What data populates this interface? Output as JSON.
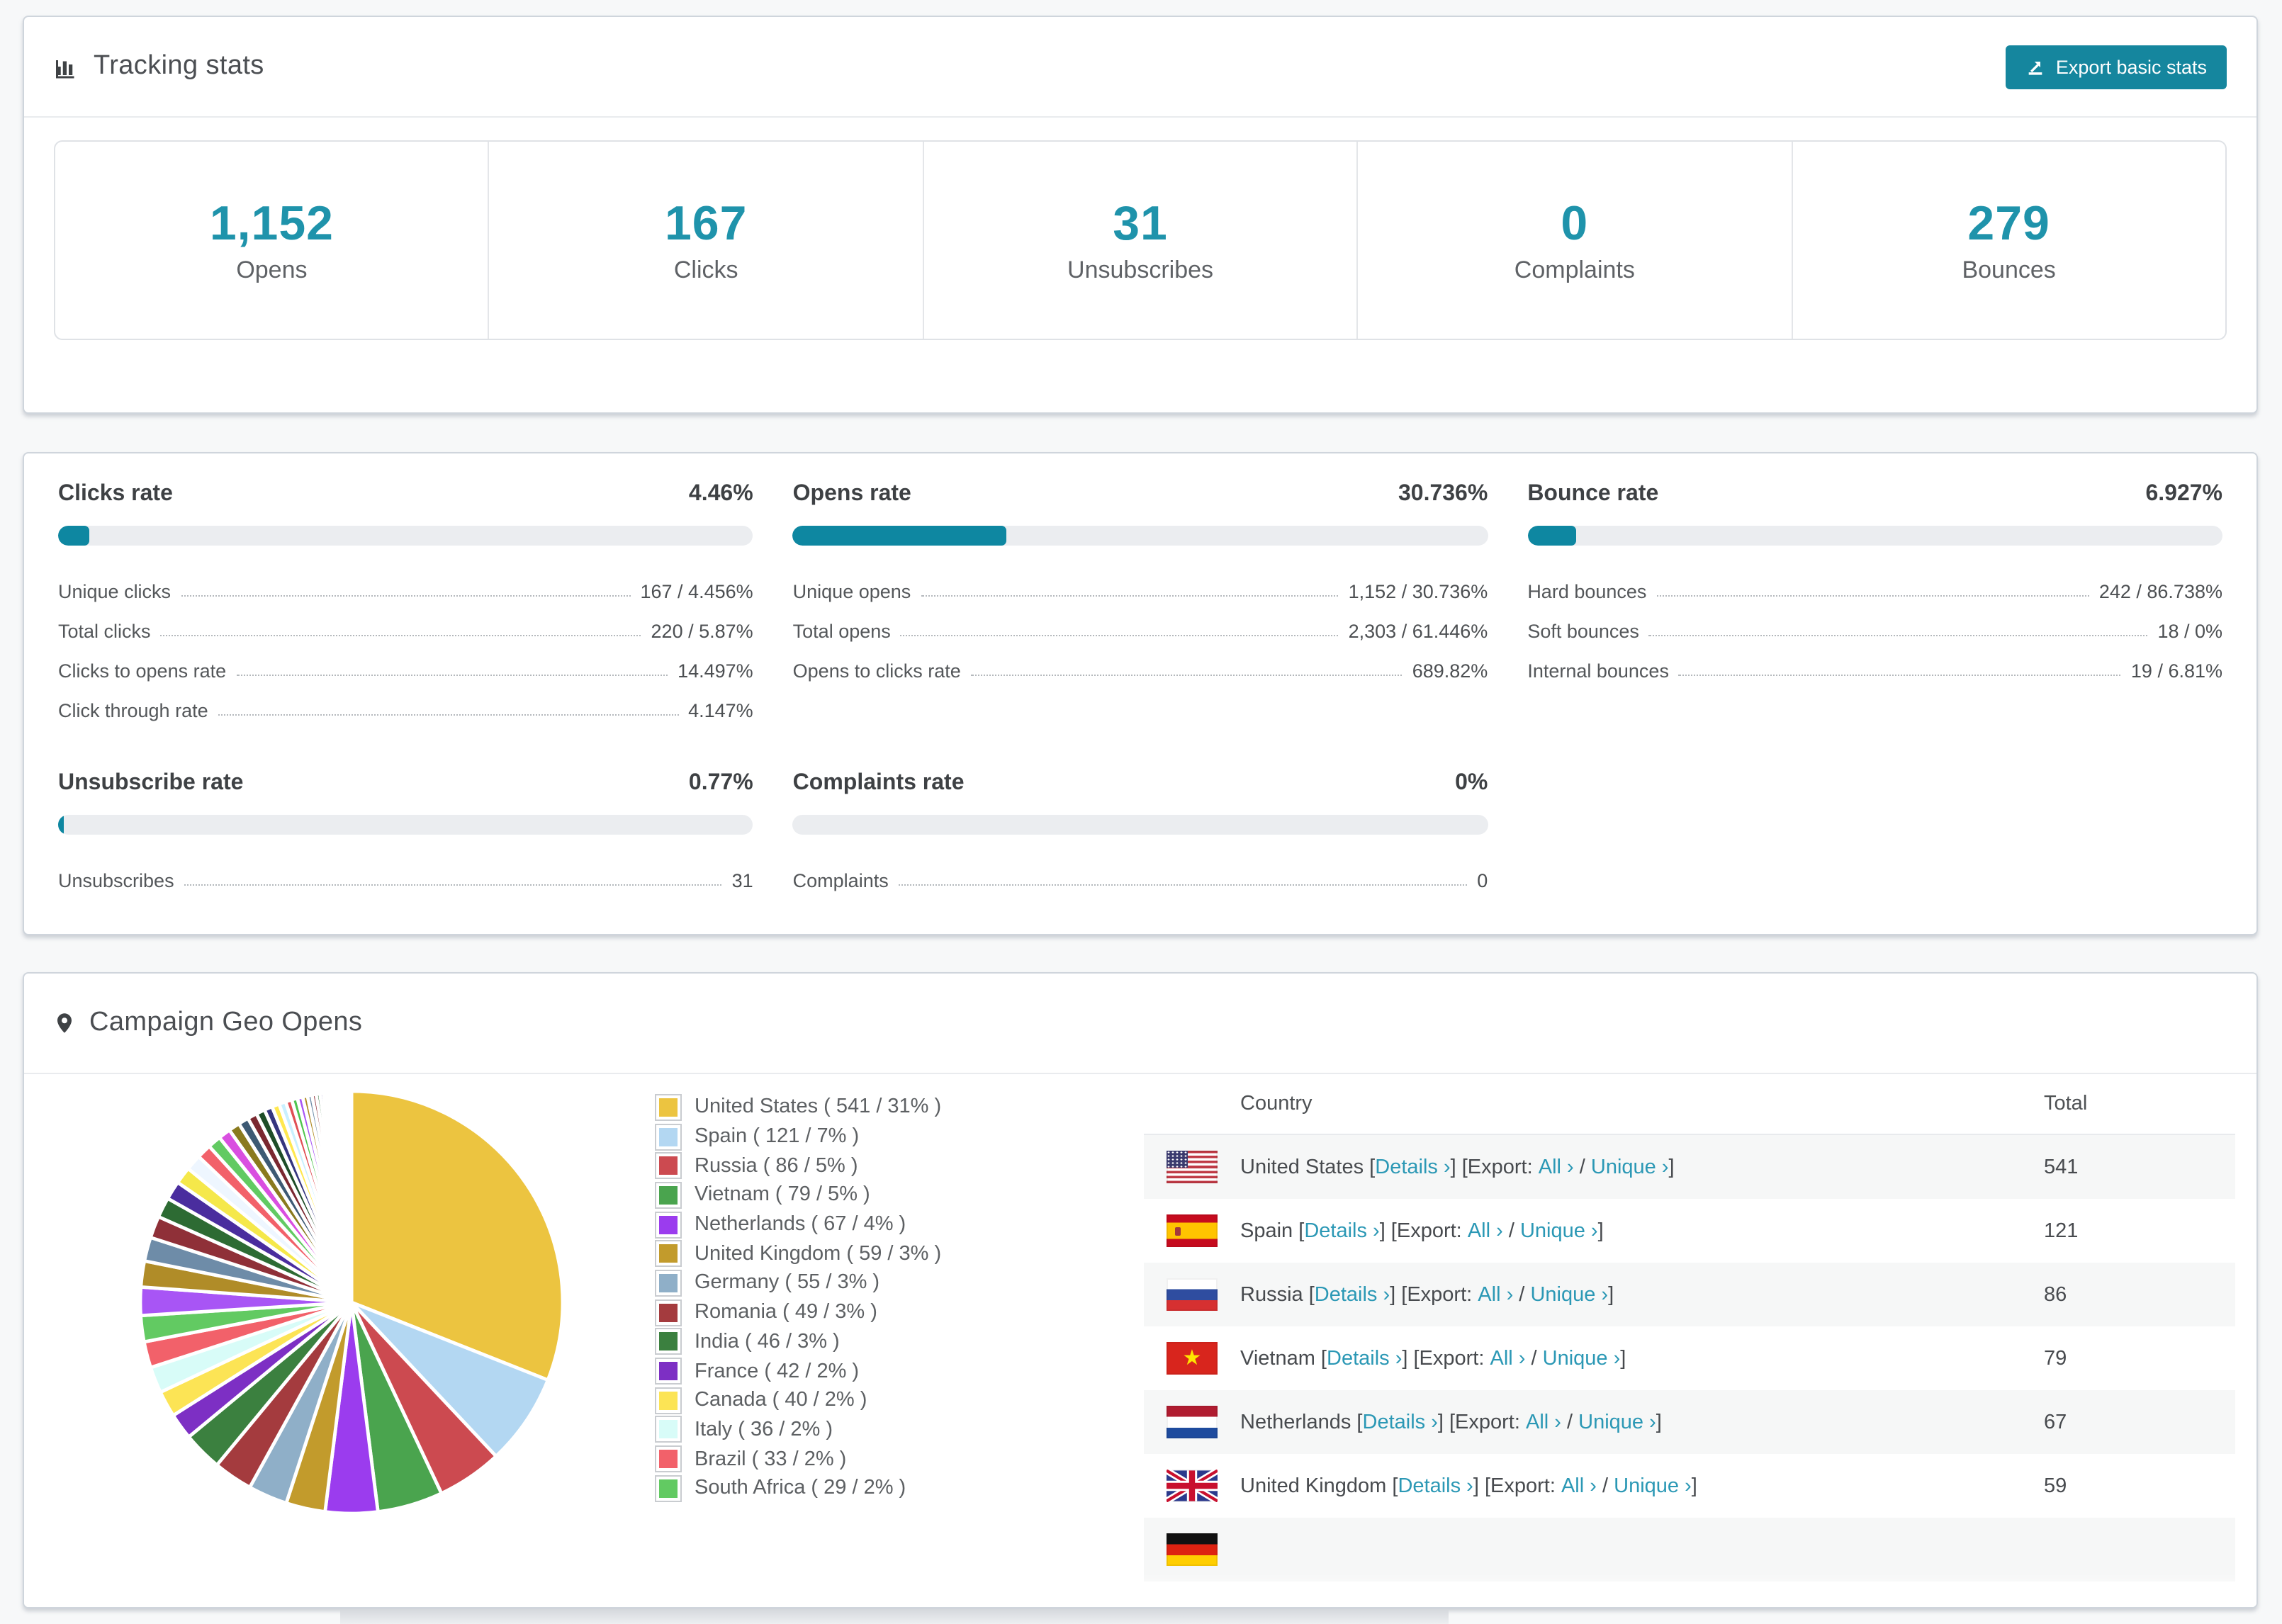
{
  "page": {
    "background": "#f7f8f9",
    "accent_teal": "#15869e",
    "bar_teal": "#0e87a1",
    "link_teal": "#2b98b5",
    "number_teal": "#1f93ab"
  },
  "tracking": {
    "title": "Tracking stats",
    "header_icon": "bar-chart-icon",
    "export_button": {
      "label": "Export basic stats",
      "icon": "export-icon"
    },
    "stats": [
      {
        "value": "1,152",
        "label": "Opens"
      },
      {
        "value": "167",
        "label": "Clicks"
      },
      {
        "value": "31",
        "label": "Unsubscribes"
      },
      {
        "value": "0",
        "label": "Complaints"
      },
      {
        "value": "279",
        "label": "Bounces"
      }
    ]
  },
  "rates": [
    {
      "id": "clicks-rate",
      "title": "Clicks rate",
      "value": "4.46%",
      "bar_percent": 4.46,
      "rows": [
        {
          "label": "Unique clicks",
          "value": "167 / 4.456%"
        },
        {
          "label": "Total clicks",
          "value": "220 / 5.87%"
        },
        {
          "label": "Clicks to opens rate",
          "value": "14.497%"
        },
        {
          "label": "Click through rate",
          "value": "4.147%"
        }
      ]
    },
    {
      "id": "opens-rate",
      "title": "Opens rate",
      "value": "30.736%",
      "bar_percent": 30.736,
      "rows": [
        {
          "label": "Unique opens",
          "value": "1,152 / 30.736%"
        },
        {
          "label": "Total opens",
          "value": "2,303 / 61.446%"
        },
        {
          "label": "Opens to clicks rate",
          "value": "689.82%"
        }
      ]
    },
    {
      "id": "bounce-rate",
      "title": "Bounce rate",
      "value": "6.927%",
      "bar_percent": 6.927,
      "rows": [
        {
          "label": "Hard bounces",
          "value": "242 / 86.738%"
        },
        {
          "label": "Soft bounces",
          "value": "18 / 0%"
        },
        {
          "label": "Internal bounces",
          "value": "19 / 6.81%"
        }
      ]
    },
    {
      "id": "unsubscribe-rate",
      "title": "Unsubscribe rate",
      "value": "0.77%",
      "bar_percent": 0.77,
      "rows": [
        {
          "label": "Unsubscribes",
          "value": "31"
        }
      ]
    },
    {
      "id": "complaints-rate",
      "title": "Complaints rate",
      "value": "0%",
      "bar_percent": 0,
      "rows": [
        {
          "label": "Complaints",
          "value": "0"
        }
      ]
    }
  ],
  "geo": {
    "title": "Campaign Geo Opens",
    "header_icon": "map-pin-icon",
    "columns": {
      "country": "Country",
      "total": "Total"
    },
    "links": {
      "details": "Details",
      "export": "Export:",
      "all": "All",
      "unique": "Unique",
      "chevron": "›",
      "bracket_open": "[",
      "bracket_close": "]",
      "separator": "/"
    },
    "rows": [
      {
        "country": "United States",
        "flag": "us",
        "total": "541",
        "partial": false
      },
      {
        "country": "Spain",
        "flag": "es",
        "total": "121",
        "partial": false
      },
      {
        "country": "Russia",
        "flag": "ru",
        "total": "86",
        "partial": false
      },
      {
        "country": "Vietnam",
        "flag": "vn",
        "total": "79",
        "partial": false
      },
      {
        "country": "Netherlands",
        "flag": "nl",
        "total": "67",
        "partial": false
      },
      {
        "country": "United Kingdom",
        "flag": "gb",
        "total": "59",
        "partial": false
      },
      {
        "country": "",
        "flag": "de",
        "total": "",
        "partial": true
      }
    ]
  },
  "chart_data": {
    "type": "pie",
    "title": "Campaign Geo Opens",
    "value_unit": "opens",
    "start_angle_deg": -90,
    "direction": "clockwise",
    "legend_position": "right-of-pie",
    "legend_label_format": "{name} ( {value} / {percent}% )",
    "slices": [
      {
        "label": "United States",
        "value": 541,
        "percent": 31,
        "color": "#ecc440"
      },
      {
        "label": "Spain",
        "value": 121,
        "percent": 7,
        "color": "#b3d7f2"
      },
      {
        "label": "Russia",
        "value": 86,
        "percent": 5,
        "color": "#cc4a50"
      },
      {
        "label": "Vietnam",
        "value": 79,
        "percent": 5,
        "color": "#4aa44e"
      },
      {
        "label": "Netherlands",
        "value": 67,
        "percent": 4,
        "color": "#9b3cee"
      },
      {
        "label": "United Kingdom",
        "value": 59,
        "percent": 3,
        "color": "#c29b2c"
      },
      {
        "label": "Germany",
        "value": 55,
        "percent": 3,
        "color": "#8fafc8"
      },
      {
        "label": "Romania",
        "value": 49,
        "percent": 3,
        "color": "#a43b3e"
      },
      {
        "label": "India",
        "value": 46,
        "percent": 3,
        "color": "#3b803f"
      },
      {
        "label": "France",
        "value": 42,
        "percent": 2,
        "color": "#7d2fc4"
      },
      {
        "label": "Canada",
        "value": 40,
        "percent": 2,
        "color": "#fce455"
      },
      {
        "label": "Italy",
        "value": 36,
        "percent": 2,
        "color": "#d8fcf8"
      },
      {
        "label": "Brazil",
        "value": 33,
        "percent": 2,
        "color": "#f2616a"
      },
      {
        "label": "South Africa",
        "value": 29,
        "percent": 2,
        "color": "#62ca62"
      }
    ],
    "other_slices_unlabeled": {
      "count": 40,
      "total_percent": 26,
      "decay_ratio": 0.92,
      "palette": [
        "#a855f5",
        "#b08c28",
        "#6e8ca8",
        "#8f3038",
        "#2d6b33",
        "#4a2d9e",
        "#f5e84a",
        "#eef6ff",
        "#f2616a",
        "#62ca62",
        "#d94fe0",
        "#8a7a1e",
        "#3d5a74",
        "#7a2830",
        "#1e4d28",
        "#35357e",
        "#ffe84f",
        "#c9f0ff",
        "#e04f55",
        "#4fc44f"
      ]
    }
  }
}
